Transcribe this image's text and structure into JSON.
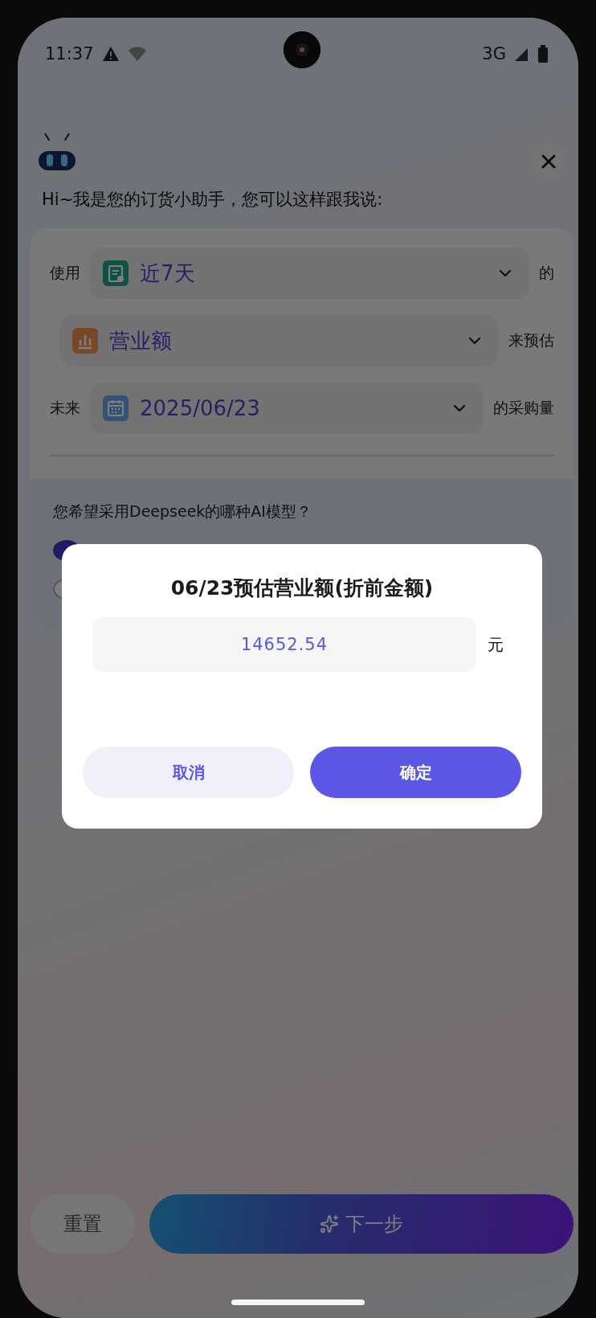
{
  "status_bar": {
    "time": "11:37",
    "network": "3G"
  },
  "assistant": {
    "greeting": "Hi~我是您的订货小助手，您可以这样跟我说:"
  },
  "form": {
    "rows": [
      {
        "prefix": "使用",
        "value": "近7天",
        "suffix": "的",
        "kind": "list"
      },
      {
        "value": "营业额",
        "suffix": "来预估",
        "kind": "chart"
      },
      {
        "prefix": "未来",
        "value": "2025/06/23",
        "suffix": "的采购量",
        "kind": "calendar"
      }
    ],
    "question": "您希望采用Deepseek的哪种AI模型？",
    "models": [
      {
        "selected": true
      },
      {
        "selected": false
      }
    ]
  },
  "dialog": {
    "title": "06/23预估营业额(折前金额)",
    "value": "14652.54",
    "unit": "元",
    "buttons": [
      {
        "label": "取消",
        "kind": "secondary"
      },
      {
        "label": "确定",
        "kind": "primary"
      }
    ]
  },
  "footer": {
    "buttons": [
      {
        "label": "重置",
        "kind": "reset"
      },
      {
        "label": "下一步",
        "kind": "ai"
      }
    ]
  }
}
